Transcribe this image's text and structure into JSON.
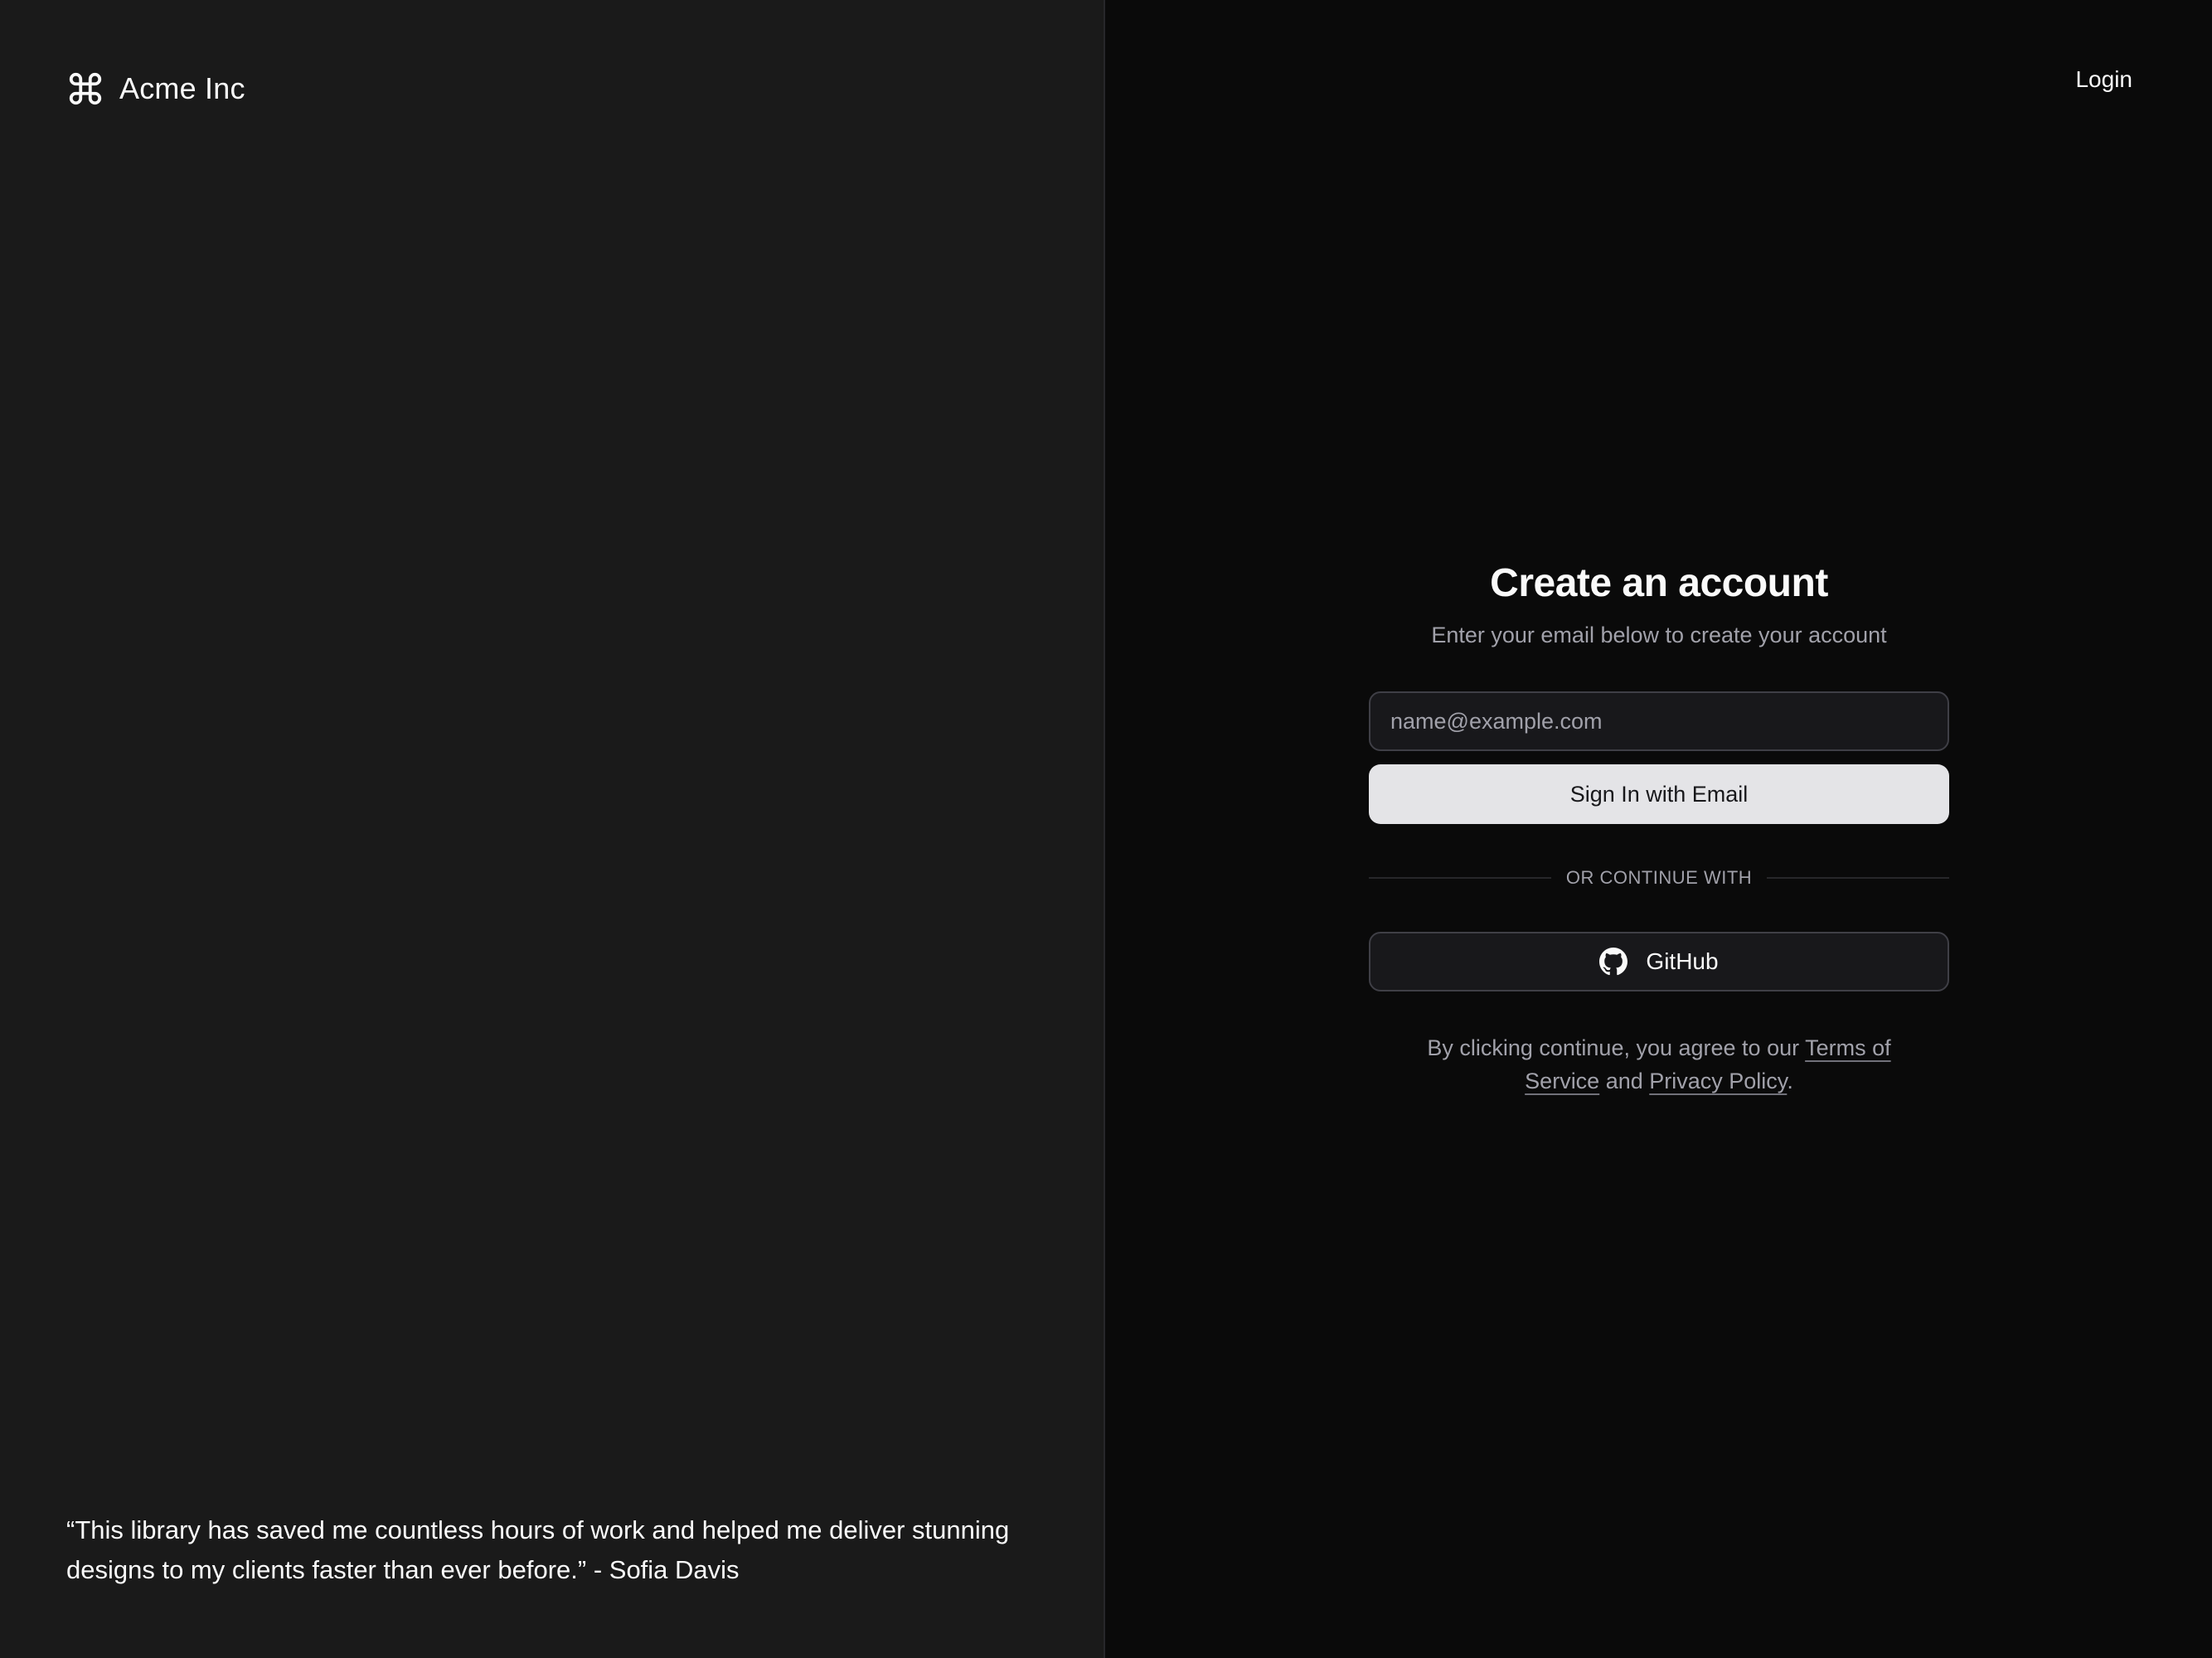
{
  "brand": {
    "name": "Acme Inc",
    "icon": "command-icon"
  },
  "testimonial": {
    "quote": "“This library has saved me countless hours of work and helped me deliver stunning designs to my clients faster than ever before.”",
    "separator": " - ",
    "author": "Sofia Davis"
  },
  "header": {
    "login_label": "Login"
  },
  "form": {
    "title": "Create an account",
    "subtitle": "Enter your email below to create your account",
    "email_placeholder": "name@example.com",
    "email_value": "",
    "submit_label": "Sign In with Email",
    "divider_label": "OR CONTINUE WITH",
    "github_label": "GitHub",
    "github_icon": "github-icon"
  },
  "terms": {
    "prefix": "By clicking continue, you agree to our ",
    "terms_link": "Terms of Service",
    "middle": " and ",
    "privacy_link": "Privacy Policy",
    "suffix": "."
  },
  "colors": {
    "left_panel_bg": "#1a1a1a",
    "right_panel_bg": "#0a0a0a",
    "primary_button_bg": "#e4e4e7",
    "muted_text": "#a1a1aa",
    "border": "#3f3f46"
  }
}
